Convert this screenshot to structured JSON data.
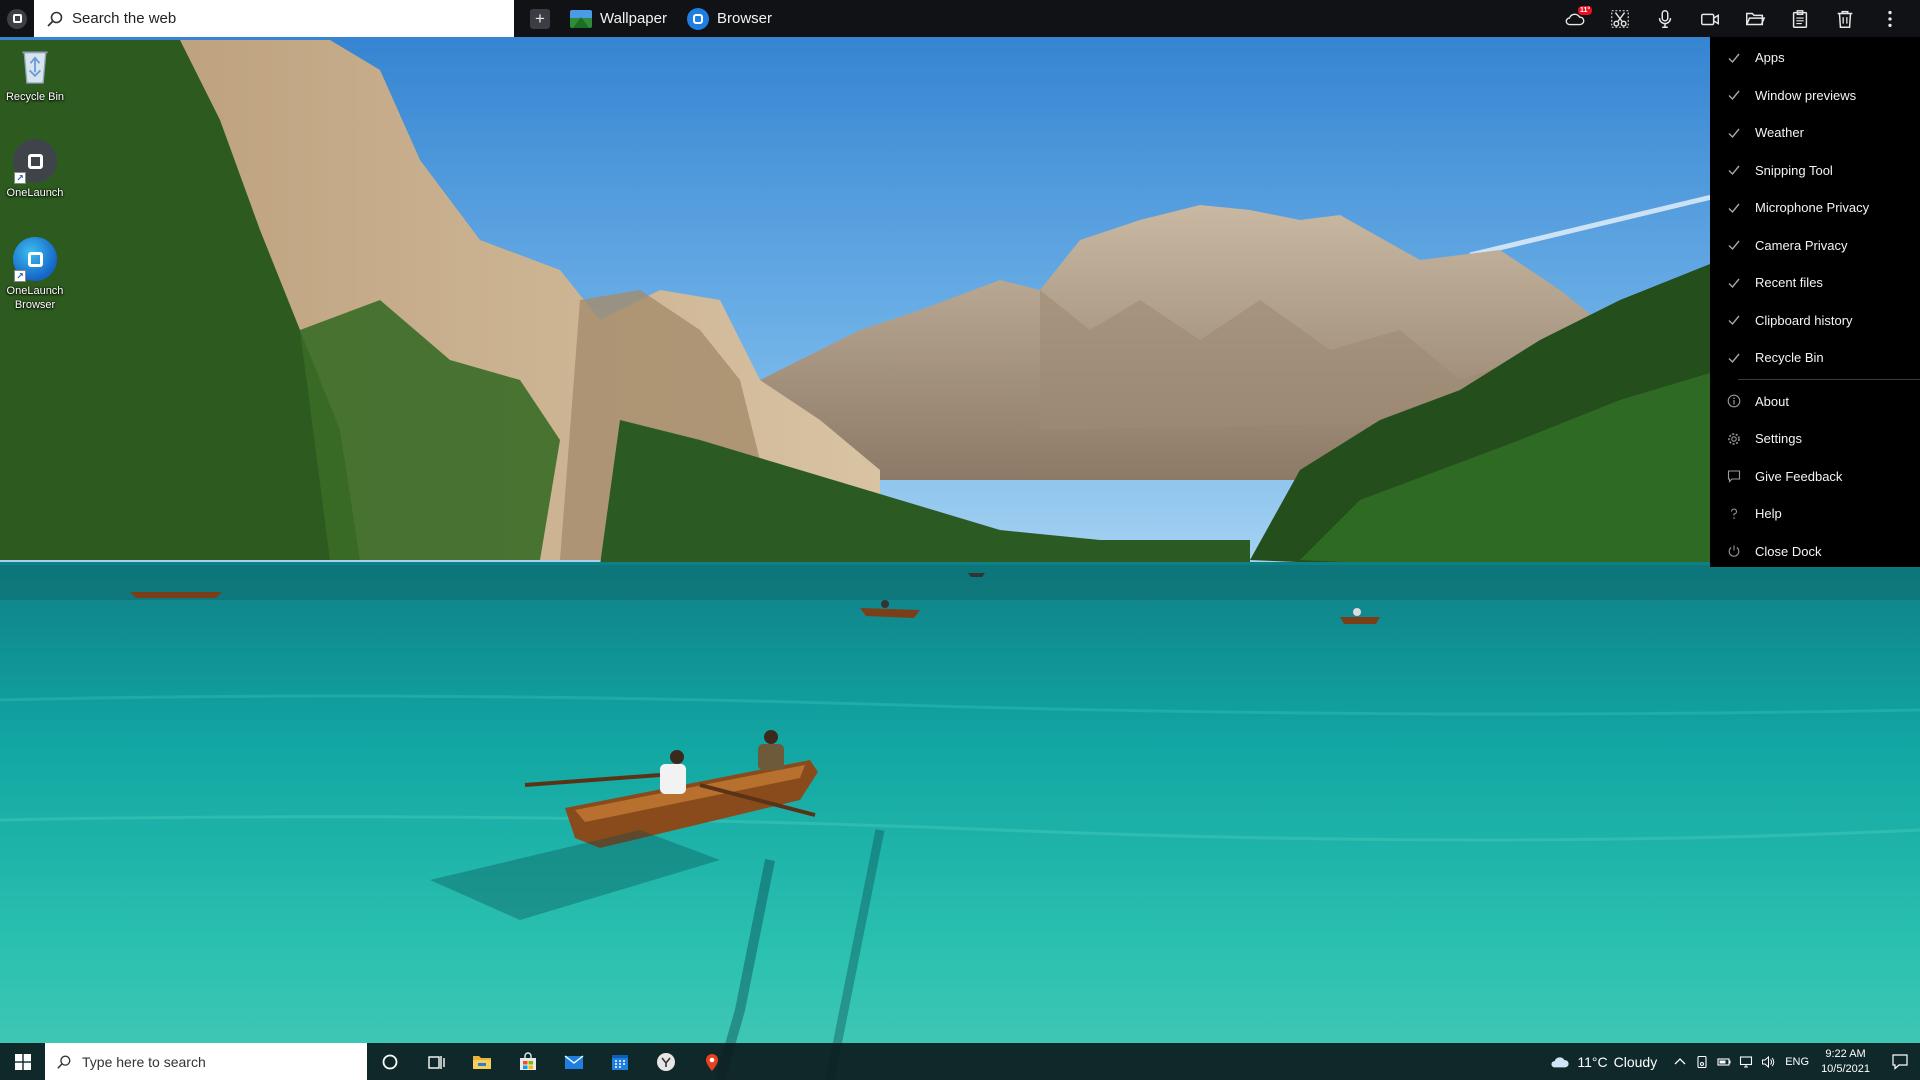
{
  "dock": {
    "search_placeholder": "Search the web",
    "apps": [
      {
        "label": "Wallpaper",
        "icon": "image-icon"
      },
      {
        "label": "Browser",
        "icon": "onelaunch-browser-icon"
      }
    ],
    "tools": [
      {
        "name": "weather",
        "icon": "cloud-icon",
        "badge": "11°"
      },
      {
        "name": "snipping-tool",
        "icon": "scissors-icon"
      },
      {
        "name": "microphone-privacy",
        "icon": "microphone-icon"
      },
      {
        "name": "camera-privacy",
        "icon": "camera-icon"
      },
      {
        "name": "recent-files",
        "icon": "folder-icon"
      },
      {
        "name": "clipboard-history",
        "icon": "clipboard-icon"
      },
      {
        "name": "recycle-bin",
        "icon": "trash-icon"
      },
      {
        "name": "more",
        "icon": "more-vertical-icon"
      }
    ],
    "menu": {
      "toggles": [
        {
          "label": "Apps",
          "checked": true
        },
        {
          "label": "Window previews",
          "checked": true
        },
        {
          "label": "Weather",
          "checked": true
        },
        {
          "label": "Snipping Tool",
          "checked": true
        },
        {
          "label": "Microphone Privacy",
          "checked": true
        },
        {
          "label": "Camera Privacy",
          "checked": true
        },
        {
          "label": "Recent files",
          "checked": true
        },
        {
          "label": "Clipboard history",
          "checked": true
        },
        {
          "label": "Recycle Bin",
          "checked": true
        }
      ],
      "actions": [
        {
          "label": "About",
          "icon": "info-icon"
        },
        {
          "label": "Settings",
          "icon": "gear-icon"
        },
        {
          "label": "Give Feedback",
          "icon": "feedback-icon"
        },
        {
          "label": "Help",
          "icon": "question-icon"
        },
        {
          "label": "Close Dock",
          "icon": "power-icon"
        }
      ]
    }
  },
  "desktop": {
    "icons": [
      {
        "label": "Recycle Bin"
      },
      {
        "label": "OneLaunch"
      },
      {
        "label": "OneLaunch Browser"
      }
    ]
  },
  "taskbar": {
    "search_placeholder": "Type here to search",
    "pinned": [
      {
        "name": "cortana",
        "icon": "circle-icon"
      },
      {
        "name": "task-view",
        "icon": "task-view-icon"
      },
      {
        "name": "file-explorer",
        "icon": "folder-icon"
      },
      {
        "name": "microsoft-store",
        "icon": "store-icon"
      },
      {
        "name": "mail",
        "icon": "mail-icon"
      },
      {
        "name": "calendar",
        "icon": "calendar-icon"
      },
      {
        "name": "onelaunch",
        "icon": "onelaunch-icon"
      },
      {
        "name": "maps",
        "icon": "map-pin-icon"
      }
    ],
    "weather": {
      "temp": "11°C",
      "condition": "Cloudy"
    },
    "language": "ENG",
    "clock": {
      "time": "9:22 AM",
      "date": "10/5/2021"
    }
  },
  "colors": {
    "dock_bg": "#111215",
    "menu_bg": "#000000",
    "taskbar_bg": "#0c1c1e",
    "accent_blue": "#1f7fe0",
    "badge_red": "#e81123"
  }
}
